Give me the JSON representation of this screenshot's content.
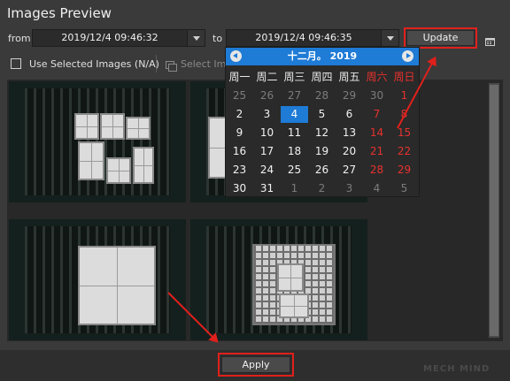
{
  "title": "Images Preview",
  "filter": {
    "from_label": "from",
    "from_value": "2019/12/4 09:46:32",
    "to_label": "to",
    "to_value": "2019/12/4 09:46:35",
    "update_label": "Update"
  },
  "options": {
    "use_selected_label": "Use Selected Images (N/A)",
    "use_selected_checked": false,
    "select_images_label": "Select Ima"
  },
  "calendar": {
    "month_title": "十二月。 2019",
    "weekdays": [
      "周一",
      "周二",
      "周三",
      "周四",
      "周五",
      "周六",
      "周日"
    ],
    "days": [
      {
        "d": "25",
        "t": "o"
      },
      {
        "d": "26",
        "t": "o"
      },
      {
        "d": "27",
        "t": "o"
      },
      {
        "d": "28",
        "t": "o"
      },
      {
        "d": "29",
        "t": "o"
      },
      {
        "d": "30",
        "t": "o"
      },
      {
        "d": "1",
        "t": "w"
      },
      {
        "d": "2",
        "t": ""
      },
      {
        "d": "3",
        "t": ""
      },
      {
        "d": "4",
        "t": "sel"
      },
      {
        "d": "5",
        "t": ""
      },
      {
        "d": "6",
        "t": ""
      },
      {
        "d": "7",
        "t": "w"
      },
      {
        "d": "8",
        "t": "w"
      },
      {
        "d": "9",
        "t": ""
      },
      {
        "d": "10",
        "t": ""
      },
      {
        "d": "11",
        "t": ""
      },
      {
        "d": "12",
        "t": ""
      },
      {
        "d": "13",
        "t": ""
      },
      {
        "d": "14",
        "t": "w"
      },
      {
        "d": "15",
        "t": "w"
      },
      {
        "d": "16",
        "t": ""
      },
      {
        "d": "17",
        "t": ""
      },
      {
        "d": "18",
        "t": ""
      },
      {
        "d": "19",
        "t": ""
      },
      {
        "d": "20",
        "t": ""
      },
      {
        "d": "21",
        "t": "w"
      },
      {
        "d": "22",
        "t": "w"
      },
      {
        "d": "23",
        "t": ""
      },
      {
        "d": "24",
        "t": ""
      },
      {
        "d": "25",
        "t": ""
      },
      {
        "d": "26",
        "t": ""
      },
      {
        "d": "27",
        "t": ""
      },
      {
        "d": "28",
        "t": "w"
      },
      {
        "d": "29",
        "t": "w"
      },
      {
        "d": "30",
        "t": ""
      },
      {
        "d": "31",
        "t": ""
      },
      {
        "d": "1",
        "t": "o"
      },
      {
        "d": "2",
        "t": "o"
      },
      {
        "d": "3",
        "t": "o"
      },
      {
        "d": "4",
        "t": "o"
      },
      {
        "d": "5",
        "t": "o"
      }
    ]
  },
  "gallery": {
    "images": [
      {
        "kind": "cartons"
      },
      {
        "kind": "cartons"
      },
      {
        "kind": "cartons"
      },
      {
        "kind": "pallet-cartons"
      }
    ]
  },
  "apply_label": "Apply",
  "watermark": "MECH MIND",
  "colors": {
    "accent": "#1e7bd6",
    "highlight": "#e0201c",
    "weekend": "#e8322e"
  }
}
